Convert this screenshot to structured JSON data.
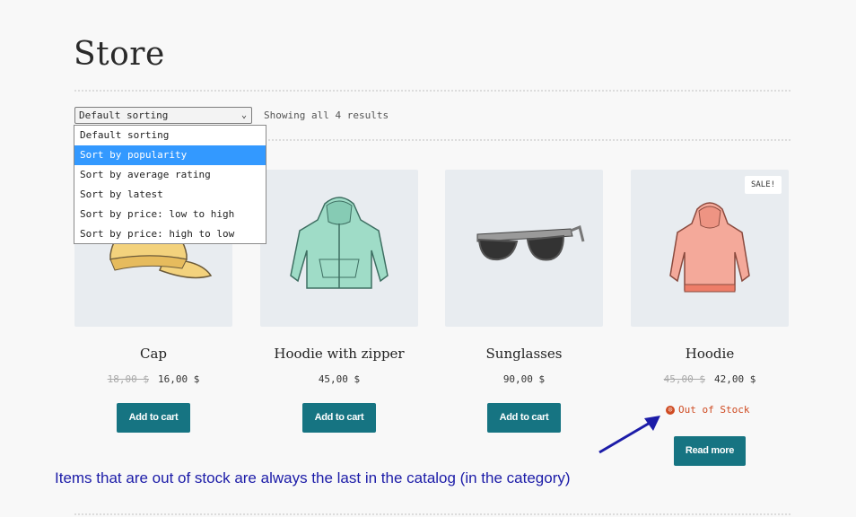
{
  "page": {
    "title": "Store"
  },
  "sorting": {
    "selected": "Default sorting",
    "options": [
      "Default sorting",
      "Sort by popularity",
      "Sort by average rating",
      "Sort by latest",
      "Sort by price: low to high",
      "Sort by price: high to low"
    ],
    "highlighted_option": "Sort by popularity",
    "results_text": "Showing all 4 results"
  },
  "products": [
    {
      "name": "Cap",
      "old_price": "18,00 $",
      "price": "16,00 $",
      "button": "Add to cart"
    },
    {
      "name": "Hoodie with zipper",
      "price": "45,00 $",
      "button": "Add to cart"
    },
    {
      "name": "Sunglasses",
      "price": "90,00 $",
      "button": "Add to cart"
    },
    {
      "name": "Hoodie",
      "old_price": "45,00 $",
      "price": "42,00 $",
      "badge": "SALE!",
      "stock_status": "Out of Stock",
      "button": "Read more"
    }
  ],
  "annotation": {
    "text": "Items that are out of stock are always the last in the catalog (in the category)",
    "color": "#1c1ca8"
  },
  "colors": {
    "button": "#167482",
    "out_of_stock": "#cf4b22",
    "dropdown_highlight": "#3399ff"
  }
}
